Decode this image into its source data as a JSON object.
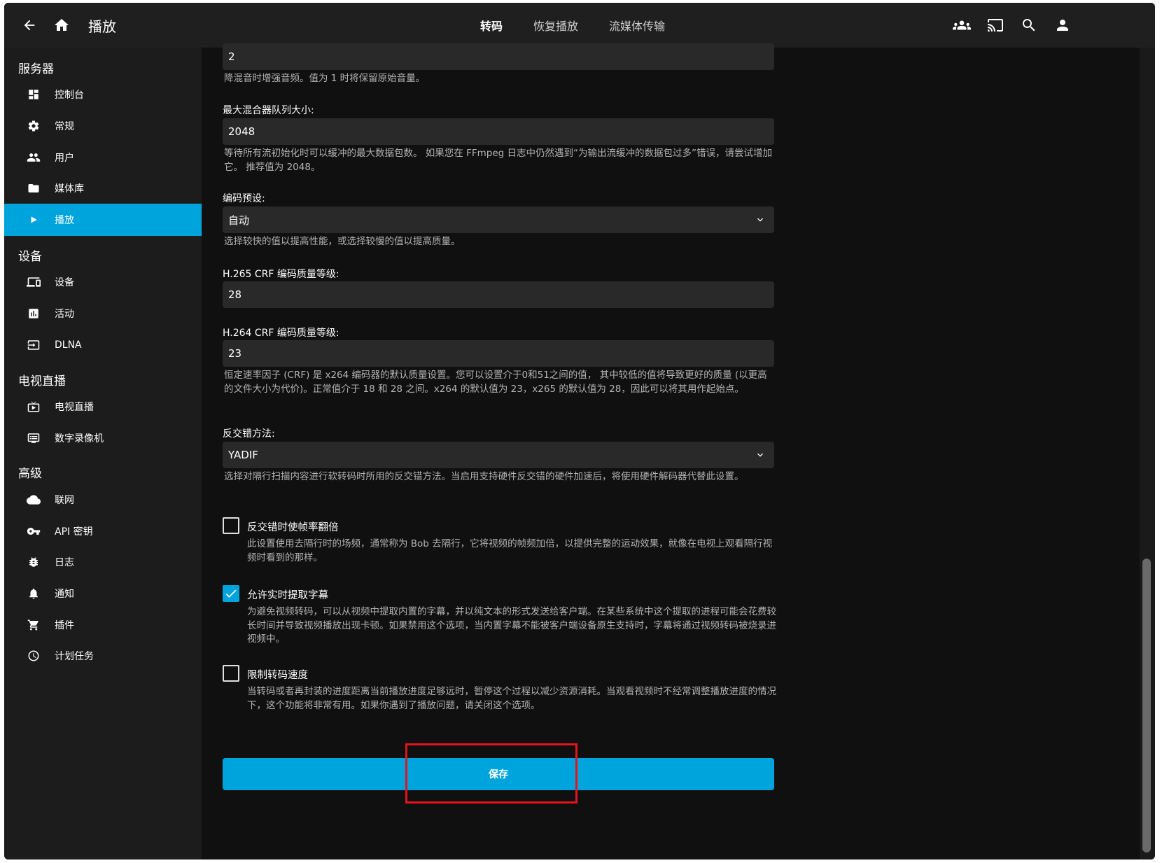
{
  "header": {
    "title": "播放",
    "tabs": [
      {
        "label": "转码",
        "active": true
      },
      {
        "label": "恢复播放",
        "active": false
      },
      {
        "label": "流媒体传输",
        "active": false
      }
    ],
    "icons": [
      "back-arrow-icon",
      "home-icon",
      "users-icon",
      "cast-icon",
      "search-icon",
      "user-icon"
    ]
  },
  "sidebar": {
    "sections": [
      {
        "title": "服务器",
        "items": [
          {
            "label": "控制台",
            "icon": "dashboard-icon"
          },
          {
            "label": "常规",
            "icon": "gear-icon"
          },
          {
            "label": "用户",
            "icon": "people-icon"
          },
          {
            "label": "媒体库",
            "icon": "folder-icon"
          },
          {
            "label": "播放",
            "icon": "play-icon",
            "active": true
          }
        ]
      },
      {
        "title": "设备",
        "items": [
          {
            "label": "设备",
            "icon": "devices-icon"
          },
          {
            "label": "活动",
            "icon": "activity-icon"
          },
          {
            "label": "DLNA",
            "icon": "input-icon"
          }
        ]
      },
      {
        "title": "电视直播",
        "items": [
          {
            "label": "电视直播",
            "icon": "live-tv-icon"
          },
          {
            "label": "数字录像机",
            "icon": "dvr-icon"
          }
        ]
      },
      {
        "title": "高级",
        "items": [
          {
            "label": "联网",
            "icon": "cloud-icon"
          },
          {
            "label": "API 密钥",
            "icon": "key-icon"
          },
          {
            "label": "日志",
            "icon": "bug-icon"
          },
          {
            "label": "通知",
            "icon": "bell-icon"
          },
          {
            "label": "插件",
            "icon": "cart-icon"
          },
          {
            "label": "计划任务",
            "icon": "clock-icon"
          }
        ]
      }
    ]
  },
  "main": {
    "downmix_value": "2",
    "downmix_help": "降混音时增强音频。值为 1 时将保留原始音量。",
    "max_muxing": {
      "label": "最大混合器队列大小:",
      "value": "2048",
      "help": "等待所有流初始化时可以缓冲的最大数据包数。 如果您在 FFmpeg 日志中仍然遇到“为输出流缓冲的数据包过多”错误，请尝试增加它。 推荐值为 2048。"
    },
    "encoding_preset": {
      "label": "编码预设:",
      "value": "自动",
      "help": "选择较快的值以提高性能，或选择较慢的值以提高质量。"
    },
    "h265_crf": {
      "label": "H.265 CRF 编码质量等级:",
      "value": "28"
    },
    "h264_crf": {
      "label": "H.264 CRF 编码质量等级:",
      "value": "23",
      "help": "恒定速率因子 (CRF) 是 x264 编码器的默认质量设置。您可以设置介于0和51之间的值， 其中较低的值将导致更好的质量 (以更高的文件大小为代价)。正常值介于 18 和 28 之间。x264 的默认值为 23，x265 的默认值为 28，因此可以将其用作起始点。"
    },
    "deinterlace": {
      "label": "反交错方法:",
      "value": "YADIF",
      "help": "选择对隔行扫描内容进行软转码时所用的反交错方法。当启用支持硬件反交错的硬件加速后，将使用硬件解码器代替此设置。"
    },
    "double_rate": {
      "label": "反交错时使帧率翻倍",
      "checked": false,
      "help": "此设置使用去隔行时的场频，通常称为 Bob 去隔行，它将视频的帧频加倍，以提供完整的运动效果，就像在电视上观看隔行视频时看到的那样。"
    },
    "subtitle_extraction": {
      "label": "允许实时提取字幕",
      "checked": true,
      "help": "为避免视频转码，可以从视频中提取内置的字幕，并以纯文本的形式发送给客户端。在某些系统中这个提取的进程可能会花费较长时间并导致视频播放出现卡顿。如果禁用这个选项，当内置字幕不能被客户端设备原生支持时，字幕将通过视频转码被烧录进视频中。"
    },
    "throttle": {
      "label": "限制转码速度",
      "checked": false,
      "help": "当转码或者再封装的进度距离当前播放进度足够远时，暂停这个过程以减少资源消耗。当观看视频时不经常调整播放进度的情况下，这个功能将非常有用。如果你遇到了播放问题，请关闭这个选项。"
    },
    "save_label": "保存"
  },
  "colors": {
    "accent": "#00a4dc",
    "highlight_box": "#e3141b",
    "background": "#101010",
    "sidebar": "#1c1c1c",
    "header": "#1f1f1f",
    "input": "#292929"
  }
}
